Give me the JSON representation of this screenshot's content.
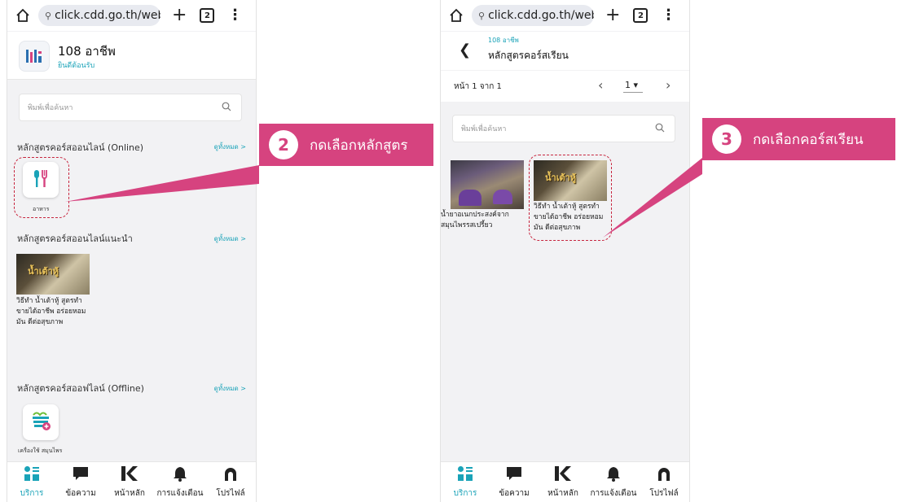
{
  "browser": {
    "url": "click.cdd.go.th/web/",
    "tab_count": "2",
    "plus": "+",
    "menu": "⋮"
  },
  "left_screen": {
    "app_title": "108 อาชีพ",
    "app_subtitle": "ยินดีต้อนรับ",
    "search_placeholder": "พิมพ์เพื่อค้นหา",
    "online_section": {
      "title": "หลักสูตรคอร์สออนไลน์ (Online)",
      "see_all": "ดูทั้งหมด >",
      "categories": [
        {
          "label": "อาหาร",
          "icon": "utensils-icon"
        }
      ]
    },
    "recommended_section": {
      "title": "หลักสูตรคอร์สออนไลน์แนะนำ",
      "see_all": "ดูทั้งหมด >",
      "courses": [
        {
          "title": "วิธีทำ น้ำเต้าหู้ สูตรทำขายได้อาชีพ อร่อยหอมมัน ดีต่อสุขภาพ",
          "thumb_text": "น้ำเต้าหู้"
        }
      ]
    },
    "offline_section": {
      "title": "หลักสูตรคอร์สออฟไลน์ (Offline)",
      "see_all": "ดูทั้งหมด >",
      "categories": [
        {
          "label": "เครื่องใช้ สมุนไพร",
          "icon": "herb-basket-icon"
        }
      ]
    }
  },
  "right_screen": {
    "breadcrumb": "108 อาชีพ",
    "page_title": "หลักสูตรคอร์สเรียน",
    "pager": {
      "text": "หน้า 1 จาก 1",
      "selected_page": "1 ▾",
      "prev": "‹",
      "next": "›"
    },
    "search_placeholder": "พิมพ์เพื่อค้นหา",
    "courses": [
      {
        "title": "น้ำยาอเนกประสงค์จากสมุนไพรรสเปรี้ยว"
      },
      {
        "title": "วิธีทำ น้ำเต้าหู้ สูตรทำขายได้อาชีพ อร่อยหอมมัน ดีต่อสุขภาพ",
        "thumb_text": "น้ำเต้าหู้"
      }
    ]
  },
  "bottom_nav": [
    {
      "label": "บริการ",
      "icon": "services-grid-icon",
      "active": true
    },
    {
      "label": "ข้อความ",
      "icon": "chat-bubble-icon",
      "active": false
    },
    {
      "label": "หน้าหลัก",
      "icon": "home-k-logo-icon",
      "active": false
    },
    {
      "label": "การแจ้งเตือน",
      "icon": "bell-icon",
      "active": false
    },
    {
      "label": "โปรไฟล์",
      "icon": "profile-icon",
      "active": false
    }
  ],
  "annotations": [
    {
      "number": "2",
      "text": "กดเลือกหลักสูตร"
    },
    {
      "number": "3",
      "text": "กดเลือกคอร์สเรียน"
    }
  ],
  "colors": {
    "accent": "#d6437f",
    "teal": "#1aa3b8",
    "dash": "#c7253e"
  }
}
